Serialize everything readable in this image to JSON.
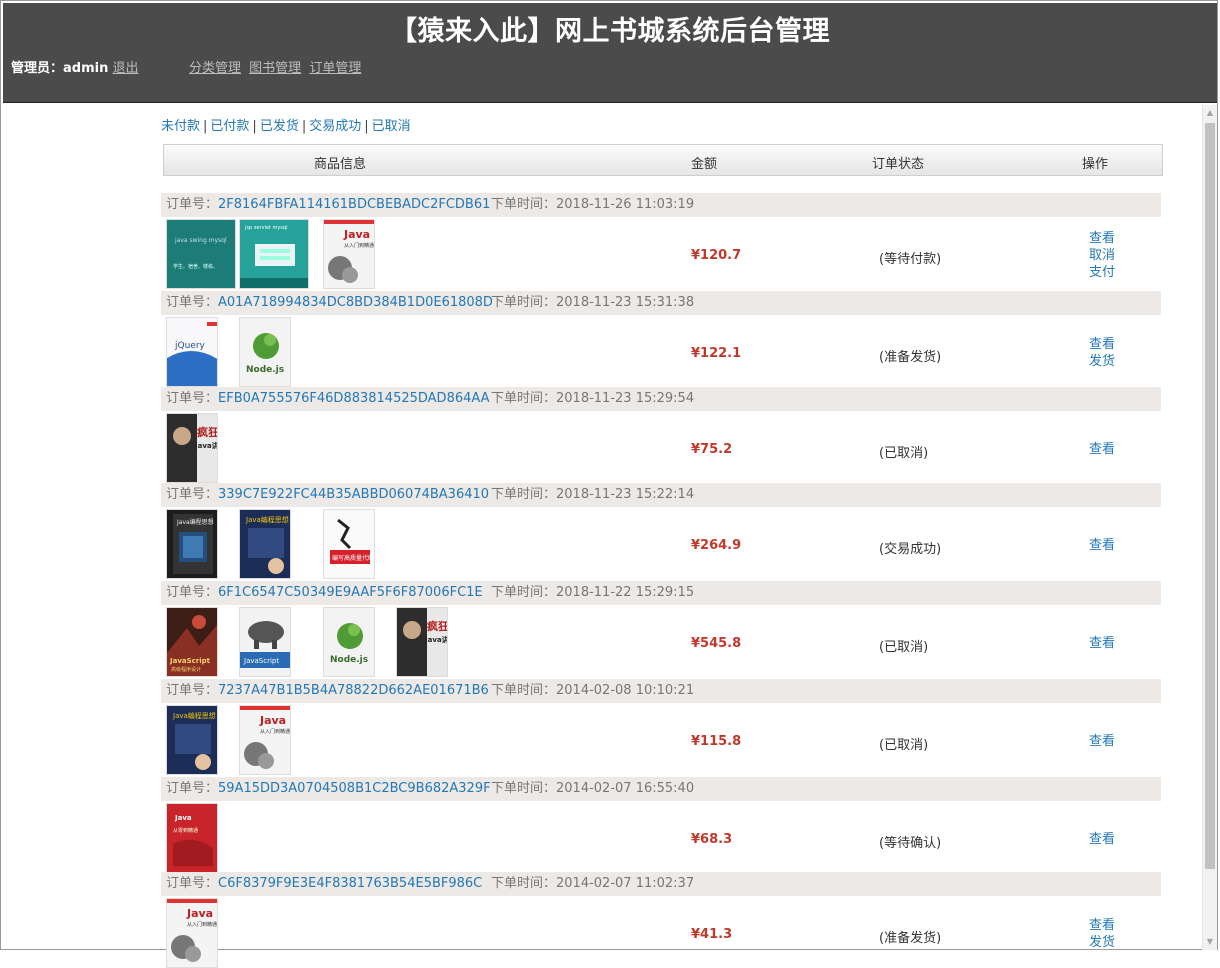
{
  "header": {
    "title": "【猿来入此】网上书城系统后台管理",
    "admin_label": "管理员：admin",
    "logout": "退出",
    "nav": [
      "分类管理",
      "图书管理",
      "订单管理"
    ]
  },
  "filters": [
    "未付款",
    "已付款",
    "已发货",
    "交易成功",
    "已取消"
  ],
  "table_headers": [
    "商品信息",
    "金额",
    "订单状态",
    "操作"
  ],
  "labels": {
    "order_no": "订单号：",
    "order_time": "下单时间："
  },
  "colors": {
    "header_bg": "#4b4b4b",
    "link": "#2478b5",
    "price": "#c0392b",
    "order_header_bg": "#ede9e6"
  },
  "orders": [
    {
      "id": "2F8164FBFA114161BDCBEBADC2FCDB61",
      "time": "2018-11-26 11:03:19",
      "price": "¥120.7",
      "status": "(等待付款)",
      "actions": [
        "查看",
        "取消",
        "支付"
      ],
      "books": [
        "book-java-swing",
        "book-jsp-servlet",
        "book-java-primer"
      ]
    },
    {
      "id": "A01A718994834DC8BD384B1D0E61808D",
      "time": "2018-11-23 15:31:38",
      "price": "¥122.1",
      "status": "(准备发货)",
      "actions": [
        "查看",
        "发货"
      ],
      "books": [
        "book-jquery",
        "book-nodejs"
      ]
    },
    {
      "id": "EFB0A755576F46D883814525DAD864AA",
      "time": "2018-11-23 15:29:54",
      "price": "¥75.2",
      "status": "(已取消)",
      "actions": [
        "查看"
      ],
      "books": [
        "book-crazy-java"
      ]
    },
    {
      "id": "339C7E922FC44B35ABBD06074BA36410",
      "time": "2018-11-23 15:22:14",
      "price": "¥264.9",
      "status": "(交易成功)",
      "actions": [
        "查看"
      ],
      "books": [
        "book-java-set",
        "book-thinking-java",
        "book-quality-code"
      ]
    },
    {
      "id": "6F1C6547C50349E9AAF5F6F87006FC1E",
      "time": "2018-11-22 15:29:15",
      "price": "¥545.8",
      "status": "(已取消)",
      "actions": [
        "查看"
      ],
      "books": [
        "book-js-advanced",
        "book-js-rhino",
        "book-nodejs",
        "book-crazy-java"
      ]
    },
    {
      "id": "7237A47B1B5B4A78822D662AE01671B6",
      "time": "2014-02-08 10:10:21",
      "price": "¥115.8",
      "status": "(已取消)",
      "actions": [
        "查看"
      ],
      "books": [
        "book-thinking-java",
        "book-java-primer"
      ]
    },
    {
      "id": "59A15DD3A0704508B1C2BC9B682A329F",
      "time": "2014-02-07 16:55:40",
      "price": "¥68.3",
      "status": "(等待确认)",
      "actions": [
        "查看"
      ],
      "books": [
        "book-java-red"
      ]
    },
    {
      "id": "C6F8379F9E3E4F8381763B54E5BF986C",
      "time": "2014-02-07 11:02:37",
      "price": "¥41.3",
      "status": "(准备发货)",
      "actions": [
        "查看",
        "发货"
      ],
      "books": [
        "book-java-primer"
      ]
    }
  ]
}
